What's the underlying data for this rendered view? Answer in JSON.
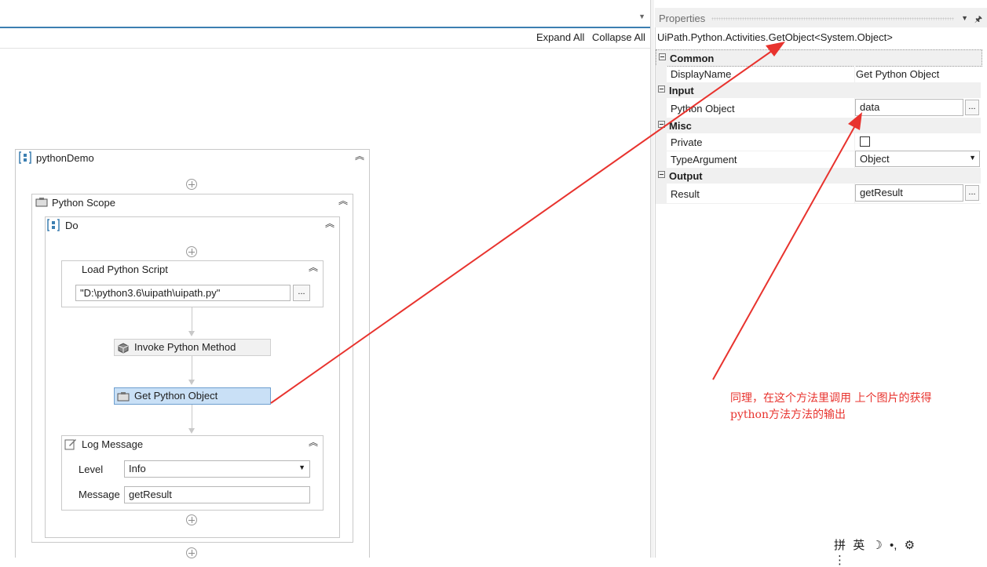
{
  "designer": {
    "expand_all": "Expand All",
    "collapse_all": "Collapse All",
    "sequence": {
      "title": "pythonDemo"
    },
    "python_scope": {
      "title": "Python Scope"
    },
    "do_sequence": {
      "title": "Do"
    },
    "load_script": {
      "title": "Load Python Script",
      "path_value": "\"D:\\python3.6\\uipath\\uipath.py\"",
      "browse_label": "..."
    },
    "invoke_method": {
      "title": "Invoke Python Method"
    },
    "get_object": {
      "title": "Get Python Object"
    },
    "log_message": {
      "title": "Log Message",
      "level_label": "Level",
      "level_value": "Info",
      "message_label": "Message",
      "message_value": "getResult"
    }
  },
  "properties": {
    "panel_title": "Properties",
    "type_name": "UiPath.Python.Activities.GetObject<System.Object>",
    "categories": {
      "common": "Common",
      "input": "Input",
      "misc": "Misc",
      "output": "Output"
    },
    "rows": {
      "display_name": {
        "label": "DisplayName",
        "value": "Get Python Object"
      },
      "python_object": {
        "label": "Python Object",
        "value": "data",
        "button": "..."
      },
      "private": {
        "label": "Private",
        "checked": false
      },
      "type_argument": {
        "label": "TypeArgument",
        "value": "Object"
      },
      "result": {
        "label": "Result",
        "value": "getResult",
        "button": "..."
      }
    }
  },
  "annotation": {
    "line1": "同理，在这个方法里调用 上个图片的获得",
    "line2": "python方法方法的输出",
    "color": "#e8332e"
  },
  "ime_toolbar": {
    "grid_icon": "拼",
    "lang": "英",
    "moon": "☽",
    "punct": "•,",
    "gear": "⚙",
    "more": "⋮"
  },
  "colors": {
    "accent": "#3c7fb1",
    "selected_fill": "#c9e0f6",
    "annotation_red": "#e8332e"
  }
}
